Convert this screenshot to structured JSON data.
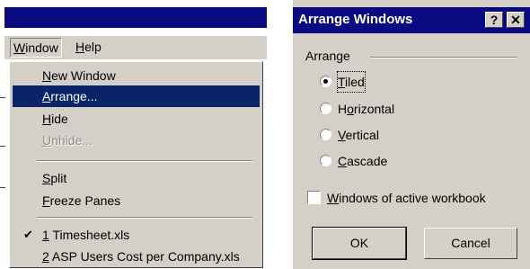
{
  "menubar": {
    "window_label": "Window",
    "help_label": "Help"
  },
  "window_menu": {
    "items": [
      {
        "label": "New Window",
        "state": "normal"
      },
      {
        "label": "Arrange...",
        "state": "highlighted"
      },
      {
        "label": "Hide",
        "state": "normal"
      },
      {
        "label": "Unhide...",
        "state": "disabled"
      },
      {
        "label": "Split",
        "state": "normal"
      },
      {
        "label": "Freeze Panes",
        "state": "normal"
      },
      {
        "label": "1 Timesheet.xls",
        "state": "checked"
      },
      {
        "label": "2 ASP Users Cost per Company.xls",
        "state": "normal"
      }
    ],
    "check_glyph": "✔"
  },
  "dialog": {
    "title": "Arrange Windows",
    "help_button": "?",
    "close_button": "✕",
    "group_label": "Arrange",
    "options": [
      {
        "label": "Tiled",
        "selected": true
      },
      {
        "label": "Horizontal",
        "selected": false
      },
      {
        "label": "Vertical",
        "selected": false
      },
      {
        "label": "Cascade",
        "selected": false
      }
    ],
    "checkbox_label": "Windows of active workbook",
    "checkbox_checked": false,
    "ok_label": "OK",
    "cancel_label": "Cancel"
  },
  "colors": {
    "title_bar": "#0a0a80",
    "menu_highlight": "#0a246a",
    "face": "#d4d0c8"
  }
}
